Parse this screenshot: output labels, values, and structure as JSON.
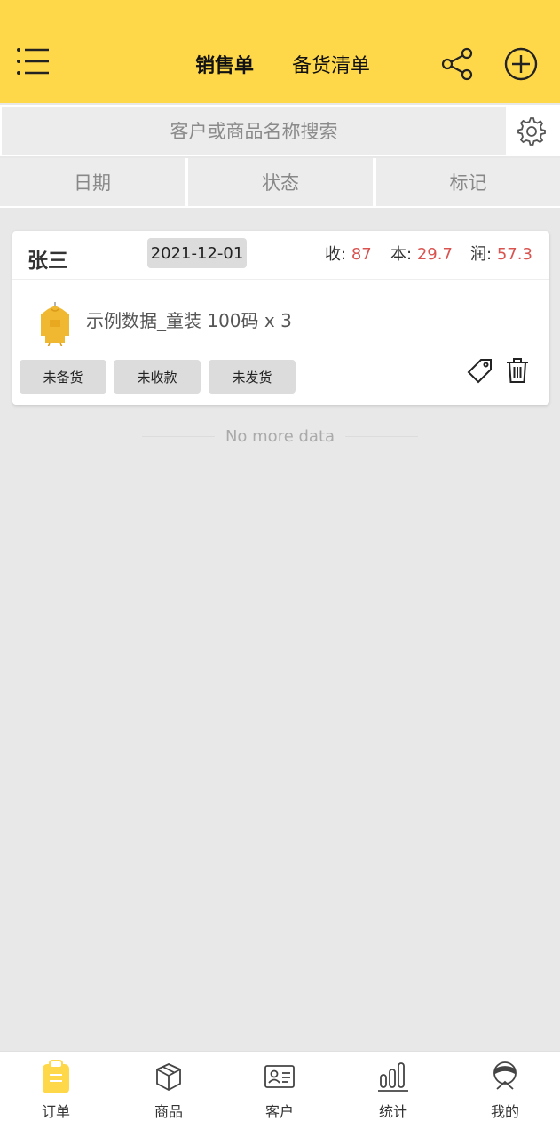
{
  "header": {
    "tabs": [
      {
        "label": "销售单",
        "active": true
      },
      {
        "label": "备货清单",
        "active": false
      }
    ],
    "icons": {
      "menu": "menu-icon",
      "share": "share-icon",
      "add": "add-circle-icon"
    },
    "accent_color": "#ffd84a"
  },
  "search": {
    "placeholder": "客户或商品名称搜索",
    "settings_icon": "gear-icon"
  },
  "filters": [
    "日期",
    "状态",
    "标记"
  ],
  "orders": [
    {
      "customer": "张三",
      "date": "2021-12-01",
      "received_label": "收:",
      "received_value": "87",
      "cost_label": "本:",
      "cost_value": "29.7",
      "profit_label": "润:",
      "profit_value": "57.3",
      "item_text": "示例数据_童装 100码 x 3",
      "status_buttons": [
        "未备货",
        "未收款",
        "未发货"
      ],
      "value_color": "#d9534f"
    }
  ],
  "list_footer": "No more data",
  "tabbar": [
    {
      "label": "订单",
      "icon": "clipboard-icon",
      "active": true
    },
    {
      "label": "商品",
      "icon": "box-icon",
      "active": false
    },
    {
      "label": "客户",
      "icon": "contact-card-icon",
      "active": false
    },
    {
      "label": "统计",
      "icon": "bar-chart-icon",
      "active": false
    },
    {
      "label": "我的",
      "icon": "profile-icon",
      "active": false
    }
  ]
}
